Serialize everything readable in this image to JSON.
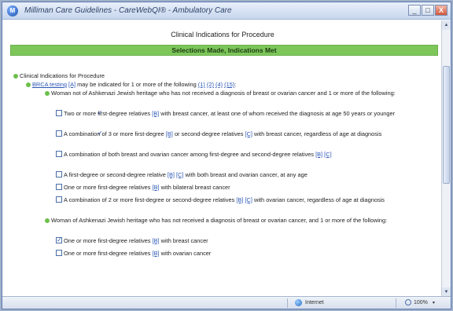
{
  "window": {
    "title": "Milliman Care Guidelines - CareWebQI® - Ambulatory Care",
    "app_icon_glyph": "M",
    "buttons": {
      "minimize": "_",
      "maximize": "□",
      "close": "X"
    }
  },
  "page": {
    "heading": "Clinical Indications for Procedure",
    "section_bar": "Selections Made, Indications Met"
  },
  "tree": {
    "root": "Clinical Indications for Procedure",
    "brca": {
      "text_pre": "BRCA testing",
      "ref": "[A]",
      "text_post": "may be indicated for 1 or more of the following",
      "refs": [
        "(1)",
        "(2)",
        "(4)",
        "(15)"
      ],
      "tail": ":"
    },
    "group1": {
      "text": "Woman not of Ashkenazi Jewish heritage who has not received a diagnosis of breast or ovarian cancer and 1 or more of the following:"
    },
    "g1_items": [
      {
        "checked": true,
        "pre": "Two or more first-degree relatives",
        "ref": "[B]",
        "post": "with breast cancer, at least one of whom received the diagnosis at age 50 years or younger",
        "refs2": []
      },
      {
        "checked": true,
        "pre": "A combination of 3 or more first-degree",
        "ref": "[B]",
        "mid": "or second-degree relatives",
        "ref2": "[C]",
        "post": "with breast cancer, regardless of age at diagnosis"
      },
      {
        "checked": false,
        "pre": "A combination of both breast and ovarian cancer among first-degree and second-degree relatives",
        "ref": "[B]",
        "ref_wrap": "[C]"
      },
      {
        "checked": false,
        "pre": "A first-degree or second-degree relative",
        "ref": "[B]",
        "ref2": "[C]",
        "post": "with both breast and ovarian cancer, at any age"
      },
      {
        "checked": false,
        "pre": "One or more first-degree relatives",
        "ref": "[B]",
        "post": "with bilateral breast cancer"
      },
      {
        "checked": false,
        "pre": "A combination of 2 or more first-degree or second-degree relatives",
        "ref": "[B]",
        "ref2": "[C]",
        "post": "with ovarian cancer, regardless of age at diagnosis"
      }
    ],
    "group2": {
      "text": "Woman of Ashkenazi Jewish heritage who has not received a diagnosis of breast or ovarian cancer, and 1 or more of the following:"
    },
    "g2_items": [
      {
        "checked": true,
        "pre": "One or more first-degree relatives",
        "ref": "[B]",
        "post": "with breast cancer"
      },
      {
        "checked": false,
        "pre": "One or more first-degree relatives",
        "ref": "[B]",
        "post": "with ovarian cancer"
      }
    ]
  },
  "statusbar": {
    "zone": "Internet",
    "zoom": "100%",
    "zoom_chevron": "▾"
  },
  "scrollbar": {
    "up": "▲",
    "down": "▼"
  },
  "colors": {
    "section_bar": "#7cc65a",
    "bullet": "#6cc04a",
    "link": "#2a56b5",
    "title_bar": "#c6d6ee"
  }
}
